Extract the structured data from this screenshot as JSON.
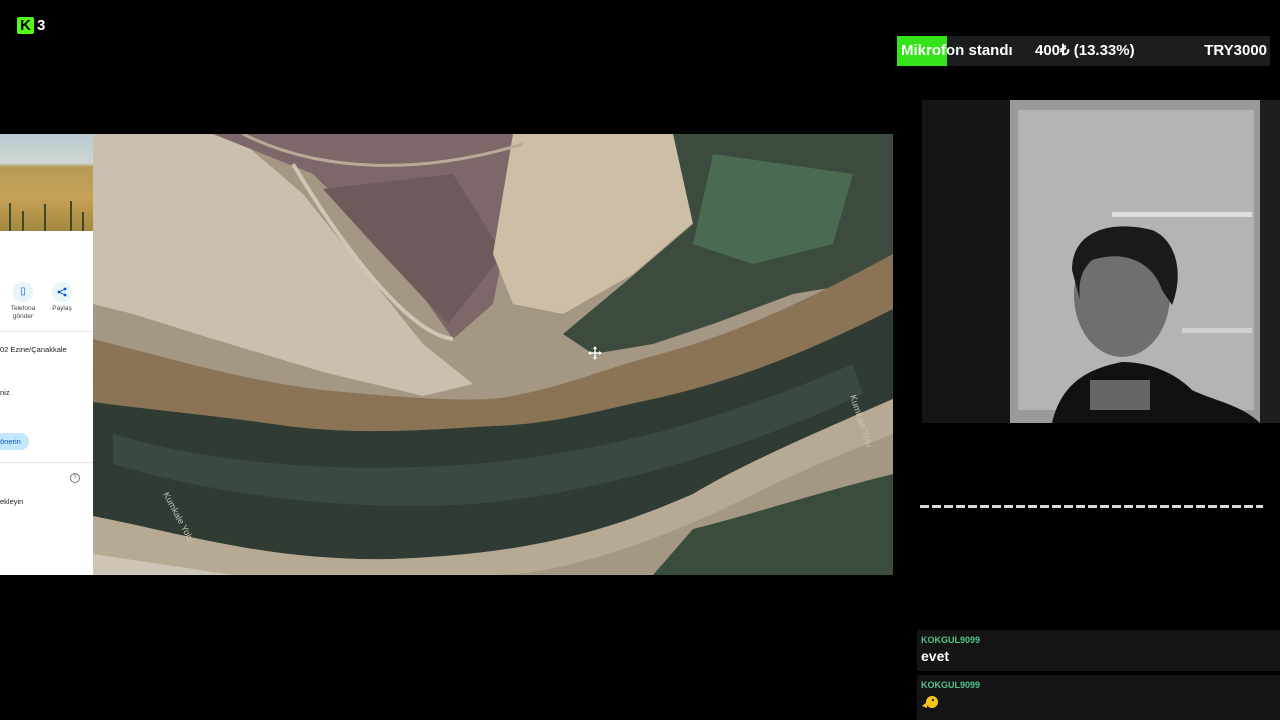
{
  "logo": {
    "text": "3"
  },
  "goal": {
    "title": "Mikrofon standı",
    "progress_text": "400₺ (13.33%)",
    "target_text": "TRY3000",
    "progress_percent": 13.33,
    "fill_color": "#35e31b"
  },
  "side_panel": {
    "actions": [
      {
        "icon": "phone-icon",
        "label_line1": "Telefona",
        "label_line2": "gönder"
      },
      {
        "icon": "share-icon",
        "label_line1": "Paylaş",
        "label_line2": ""
      }
    ],
    "address": "02 Ezine/Çanakkale",
    "text_niz": "niz",
    "suggest_button": "önerin",
    "text_ekleyin": "ekleyin"
  },
  "map": {
    "road_label_1": "Kumkale Yolu",
    "road_label_2": "Kumkale Yolu"
  },
  "chat": [
    {
      "username": "KOKGUL9099",
      "text": "evet"
    },
    {
      "username": "KOKGUL9099",
      "text": ""
    }
  ]
}
